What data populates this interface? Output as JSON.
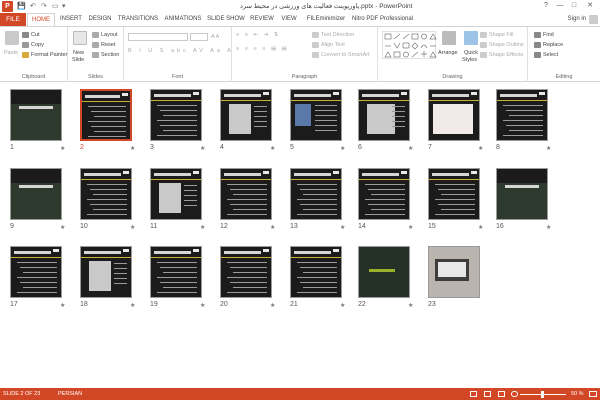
{
  "app": {
    "title": "پاورپوینت فعالیت های ورزشی در محیط سرد.pptx - PowerPoint",
    "signin": "Sign in",
    "window_controls": [
      "?",
      "—",
      "□",
      "✕"
    ]
  },
  "tabs": [
    {
      "label": "FILE",
      "active": false
    },
    {
      "label": "HOME",
      "active": true
    },
    {
      "label": "INSERT",
      "active": false
    },
    {
      "label": "DESIGN",
      "active": false
    },
    {
      "label": "TRANSITIONS",
      "active": false
    },
    {
      "label": "ANIMATIONS",
      "active": false
    },
    {
      "label": "SLIDE SHOW",
      "active": false
    },
    {
      "label": "REVIEW",
      "active": false
    },
    {
      "label": "VIEW",
      "active": false
    },
    {
      "label": "FILEminimizer",
      "active": false
    },
    {
      "label": "Nitro PDF Professional",
      "active": false
    }
  ],
  "ribbon": {
    "clipboard": {
      "label": "Clipboard",
      "paste": "Paste",
      "cut": "Cut",
      "copy": "Copy",
      "format_painter": "Format Painter"
    },
    "slides": {
      "label": "Slides",
      "new_slide": "New",
      "new_slide_2": "Slide",
      "layout": "Layout",
      "reset": "Reset",
      "section": "Section"
    },
    "font": {
      "label": "Font"
    },
    "paragraph": {
      "label": "Paragraph",
      "text_direction": "Text Direction",
      "align_text": "Align Text",
      "convert_smartart": "Convert to SmartArt"
    },
    "drawing": {
      "label": "Drawing",
      "arrange": "Arrange",
      "quick_styles": "Quick",
      "quick_styles_2": "Styles",
      "shape_fill": "Shape Fill",
      "shape_outline": "Shape Outline",
      "shape_effects": "Shape Effects"
    },
    "editing": {
      "label": "Editing",
      "find": "Find",
      "replace": "Replace",
      "select": "Select"
    }
  },
  "slides": [
    {
      "n": "1"
    },
    {
      "n": "2",
      "selected": true
    },
    {
      "n": "3"
    },
    {
      "n": "4"
    },
    {
      "n": "5"
    },
    {
      "n": "6"
    },
    {
      "n": "7"
    },
    {
      "n": "8"
    },
    {
      "n": "9"
    },
    {
      "n": "10"
    },
    {
      "n": "11"
    },
    {
      "n": "12"
    },
    {
      "n": "13"
    },
    {
      "n": "14"
    },
    {
      "n": "15"
    },
    {
      "n": "16"
    },
    {
      "n": "17"
    },
    {
      "n": "18"
    },
    {
      "n": "19"
    },
    {
      "n": "20"
    },
    {
      "n": "21"
    },
    {
      "n": "22"
    },
    {
      "n": "23"
    }
  ],
  "status": {
    "slide_info": "SLIDE 2 OF 23",
    "language": "PERSIAN",
    "zoom": "50 %"
  },
  "colors": {
    "accent": "#d24726"
  }
}
